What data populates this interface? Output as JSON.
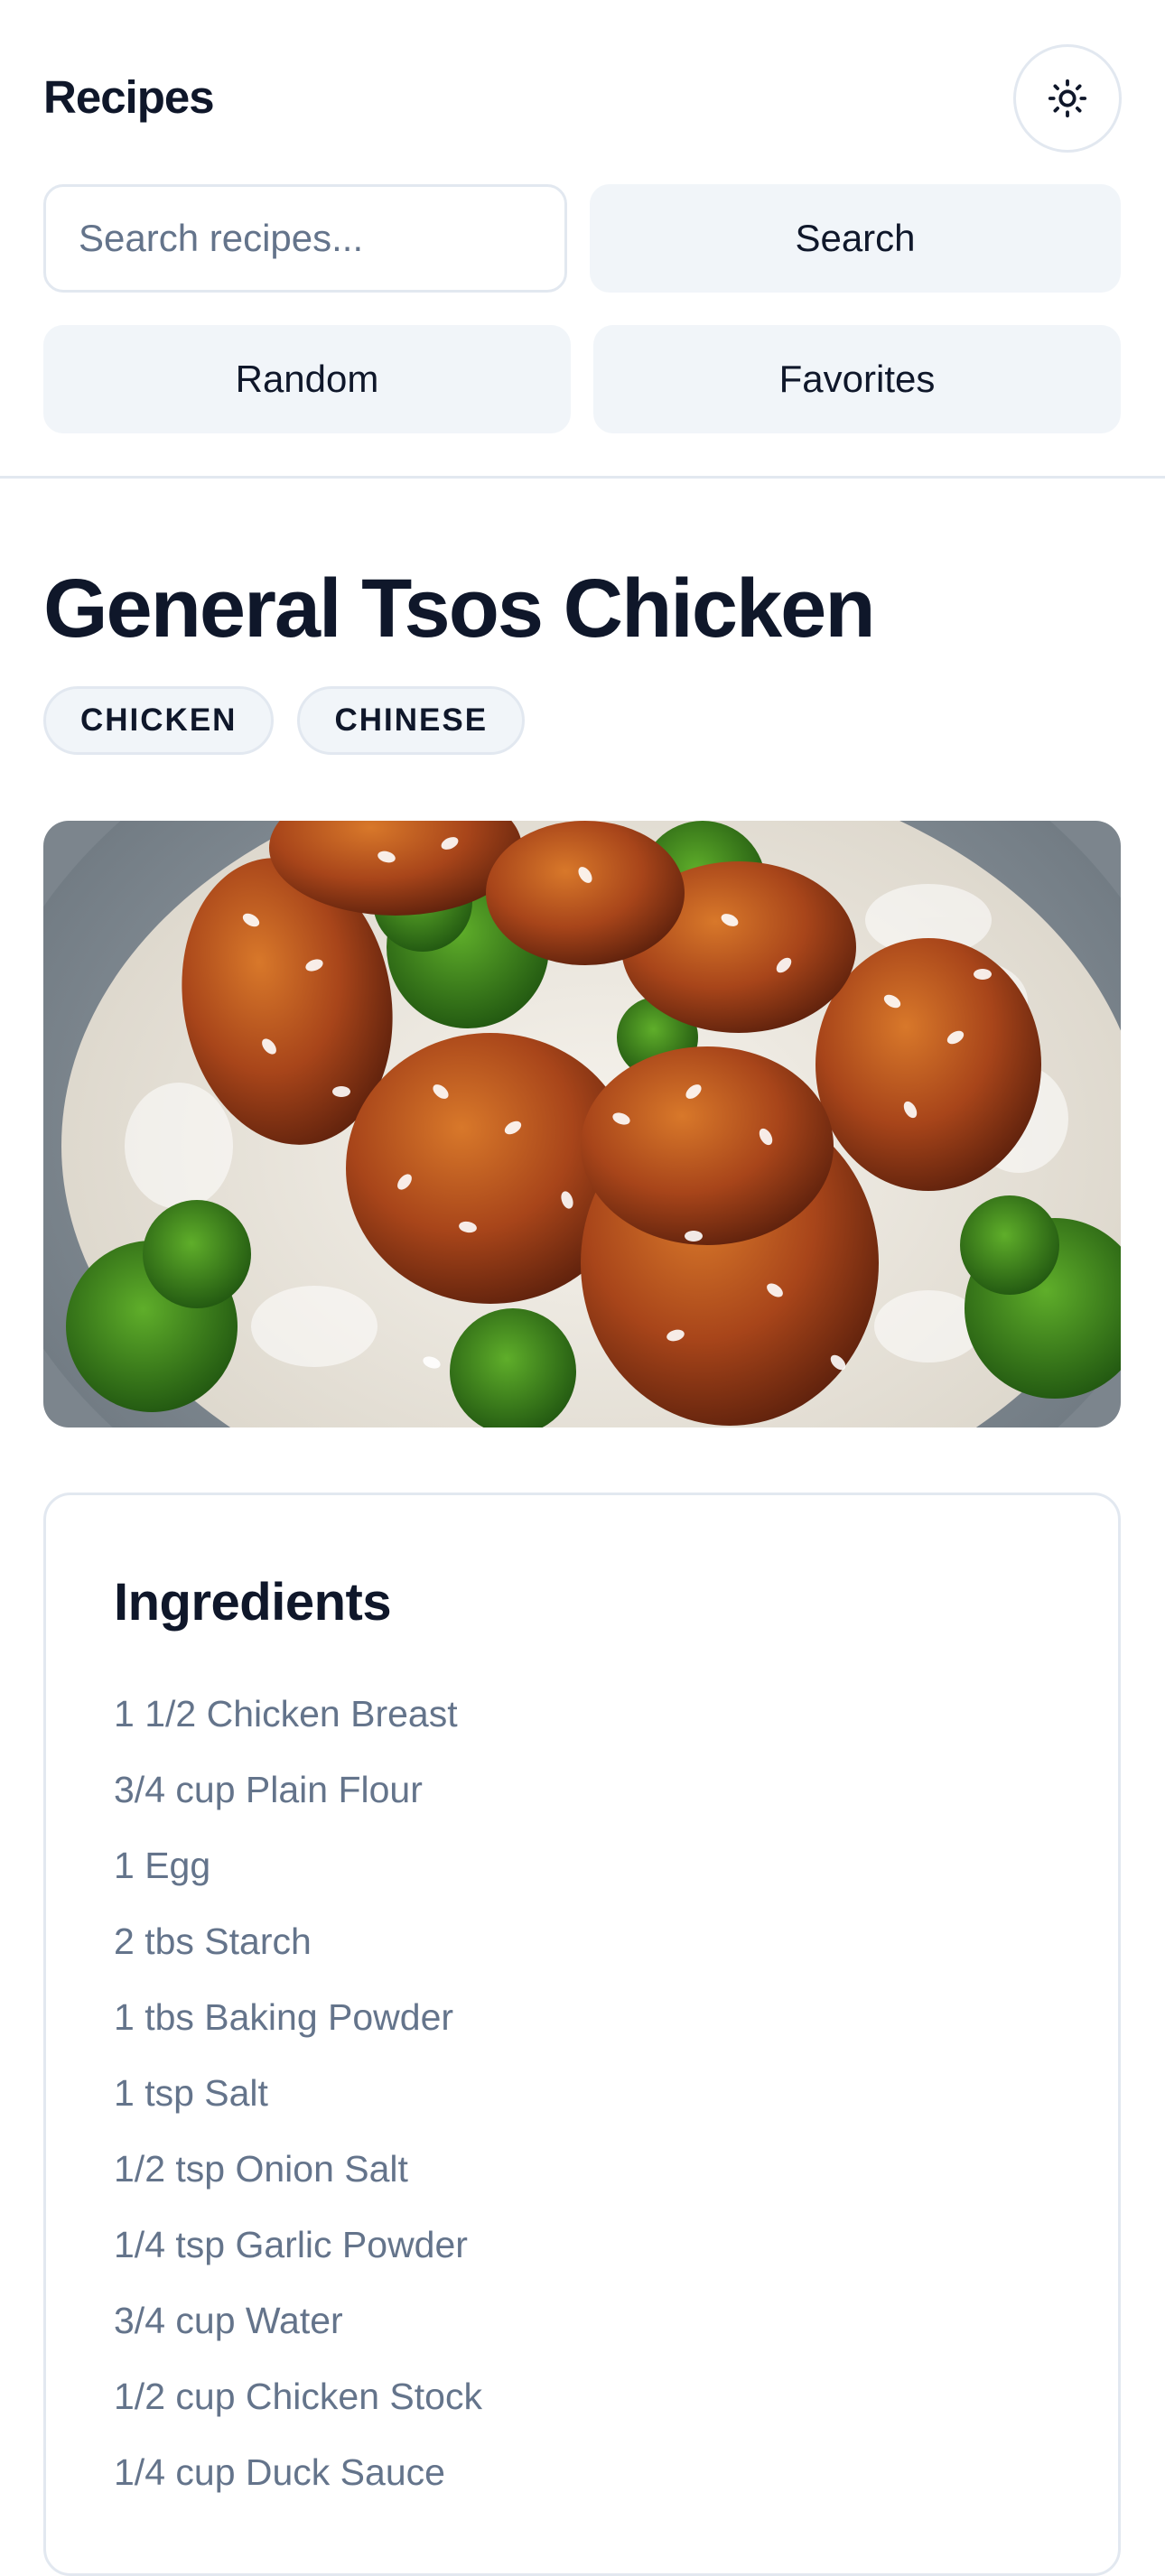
{
  "header": {
    "app_title": "Recipes",
    "theme_toggle_icon": "sun-icon",
    "search": {
      "placeholder": "Search recipes...",
      "value": "",
      "button_label": "Search"
    },
    "random_label": "Random",
    "favorites_label": "Favorites"
  },
  "recipe": {
    "title": "General Tsos Chicken",
    "tags": [
      "CHICKEN",
      "CHINESE"
    ],
    "image_subject": "General Tso's chicken with sesame seeds, broccoli and rice in a bowl",
    "ingredients": {
      "heading": "Ingredients",
      "items": [
        "1 1/2 Chicken Breast",
        "3/4 cup Plain Flour",
        "1 Egg",
        "2 tbs Starch",
        "1 tbs Baking Powder",
        "1 tsp Salt",
        "1/2 tsp Onion Salt",
        "1/4 tsp Garlic Powder",
        "3/4 cup Water",
        "1/2 cup Chicken Stock",
        "1/4 cup Duck Sauce"
      ]
    }
  },
  "colors": {
    "text_primary": "#0f172a",
    "text_muted": "#64748b",
    "border": "#e2e8f0",
    "button_bg": "#f1f5f9"
  }
}
